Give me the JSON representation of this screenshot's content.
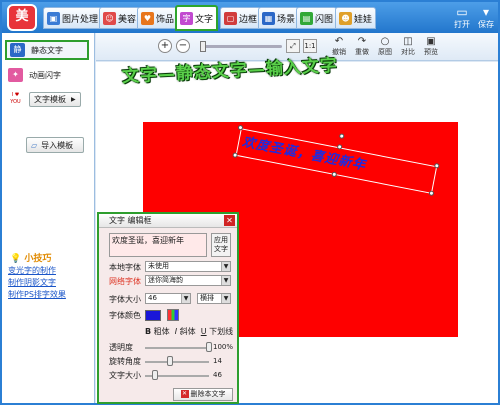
{
  "app": {
    "logo_text": "美"
  },
  "tabs": [
    {
      "label": "图片处理",
      "icon": "image-icon",
      "color": "#3a7bd5"
    },
    {
      "label": "美容",
      "icon": "face-icon",
      "color": "#e04a4a"
    },
    {
      "label": "饰品",
      "icon": "heart-icon",
      "color": "#e8761c"
    },
    {
      "label": "文字",
      "icon": "text-icon",
      "color": "#c24ad0"
    },
    {
      "label": "边框",
      "icon": "frame-icon",
      "color": "#d13c3c"
    },
    {
      "label": "场景",
      "icon": "scene-icon",
      "color": "#2b68c7"
    },
    {
      "label": "闪图",
      "icon": "flash-icon",
      "color": "#32a838"
    },
    {
      "label": "娃娃",
      "icon": "doll-icon",
      "color": "#e0a02a"
    }
  ],
  "top_actions": {
    "open": "打开",
    "save": "保存"
  },
  "sidebar": {
    "static_text": "静态文字",
    "static_icon": "静",
    "animated_text": "动画闪字",
    "text_template": "文字模板",
    "text_template_icon": "I ♥ YOU",
    "import_template": "导入模板",
    "tips_title": "小技巧",
    "tips": [
      "变光字的制作",
      "制作阴影文字",
      "制作PS排字效果"
    ]
  },
  "toolbar": {
    "undo": "撤销",
    "redo": "重做",
    "original": "原图",
    "compare": "对比",
    "preview": "预览"
  },
  "canvas": {
    "headline": "文字—静态文字—输入文字",
    "image_color": "#fe0000",
    "overlay_text": "欢度圣诞，喜迎新年",
    "overlay_color": "#1d2be0"
  },
  "editor": {
    "title": "文字 编辑框",
    "text_value": "欢度圣诞，喜迎新年",
    "apply_label": "应用文字",
    "local_font_label": "本地字体",
    "local_font_value": "未使用",
    "web_font_label": "网络字体",
    "web_font_value": "迷你简海韵",
    "font_size_label": "字体大小",
    "font_size_value": "46",
    "direction_value": "横排",
    "font_color_label": "字体颜色",
    "font_color": "#1a16d8",
    "bold": "粗体",
    "italic": "斜体",
    "underline": "下划线",
    "opacity_label": "透明度",
    "opacity_value": "100%",
    "opacity": 1.0,
    "rotation_label": "旋转角度",
    "rotation_value": "14",
    "rotation": 14,
    "text_size_label": "文字大小",
    "text_size_value": "46",
    "text_size": 46,
    "delete_label": "删除本文字"
  }
}
